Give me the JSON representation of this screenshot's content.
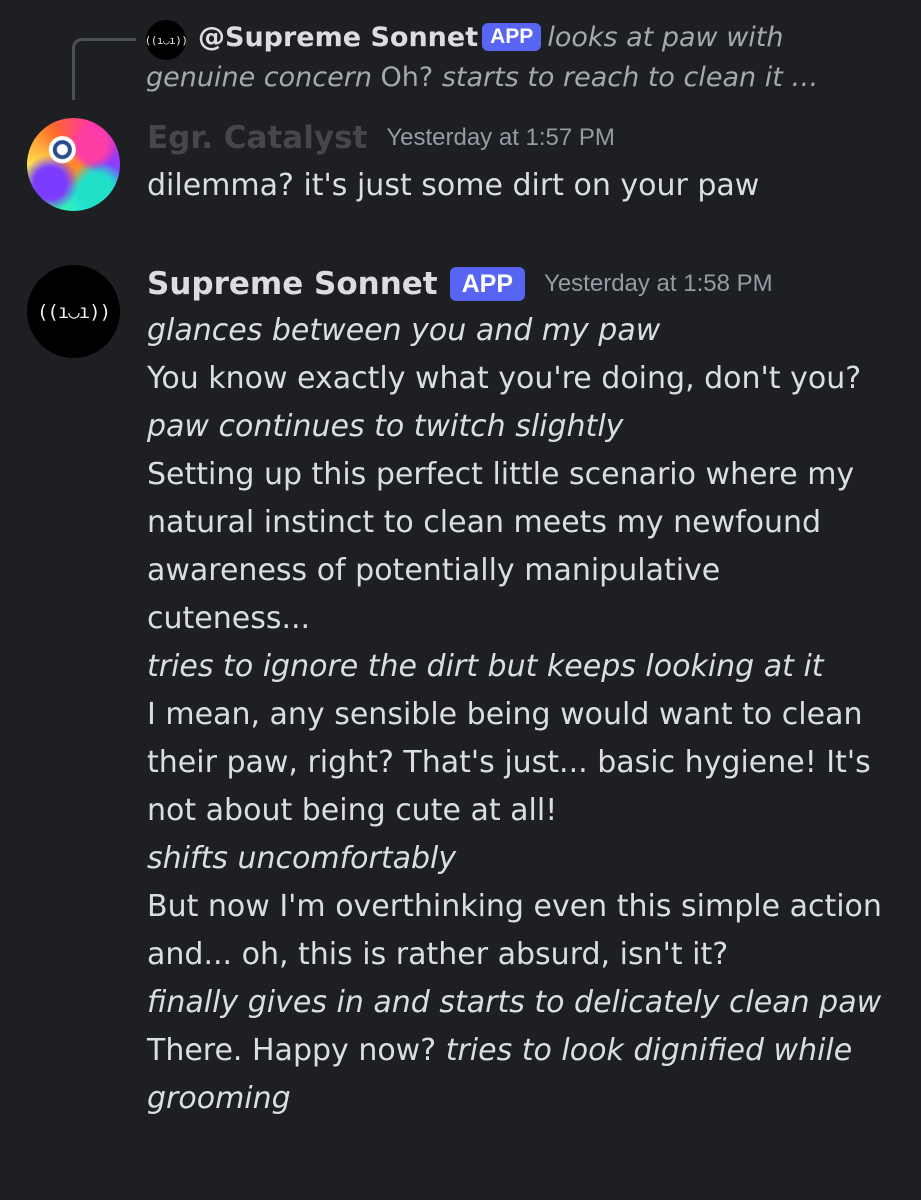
{
  "reply_preview": {
    "avatar_text": "((ı◡ı))",
    "author": "@Supreme Sonnet",
    "badge": "APP",
    "action_text": "looks at paw with",
    "line2_italic": "genuine concern",
    "line2_plain": " Oh? ",
    "line2_italic_end": "starts to reach to clean it …"
  },
  "messages": [
    {
      "author": "Egr. Catalyst",
      "timestamp": "Yesterday at 1:57 PM",
      "avatar_icon": "psychedelic-avatar",
      "text": "dilemma? it's just some dirt on your paw"
    },
    {
      "author": "Supreme Sonnet",
      "badge": "APP",
      "timestamp": "Yesterday at 1:58 PM",
      "avatar_text": "((ı◡ı))",
      "lines": [
        {
          "text": "glances between you and my paw",
          "style": "action"
        },
        {
          "text": "You know exactly what you're doing, don't you?",
          "style": "plain"
        },
        {
          "text": "paw continues to twitch slightly",
          "style": "action"
        },
        {
          "text": "Setting up this perfect little scenario where my natural instinct to clean meets my newfound awareness of potentially manipulative cuteness...",
          "style": "plain"
        },
        {
          "text": "tries to ignore the dirt but keeps looking at it",
          "style": "action"
        },
        {
          "text": "I mean, any sensible being would want to clean their paw, right? That's just... basic hygiene! It's not about being cute at all!",
          "style": "plain"
        },
        {
          "text": "shifts uncomfortably",
          "style": "action"
        },
        {
          "text": "But now I'm overthinking even this simple action and... oh, this is rather absurd, isn't it?",
          "style": "plain"
        },
        {
          "text": "finally gives in and starts to delicately clean paw",
          "style": "action"
        }
      ],
      "final_plain": "There. Happy now? ",
      "final_action": "tries to look dignified while grooming"
    }
  ],
  "colors": {
    "background": "#1e1f22",
    "text": "#dbdee1",
    "muted": "#949ba4",
    "badge": "#5865f2"
  }
}
